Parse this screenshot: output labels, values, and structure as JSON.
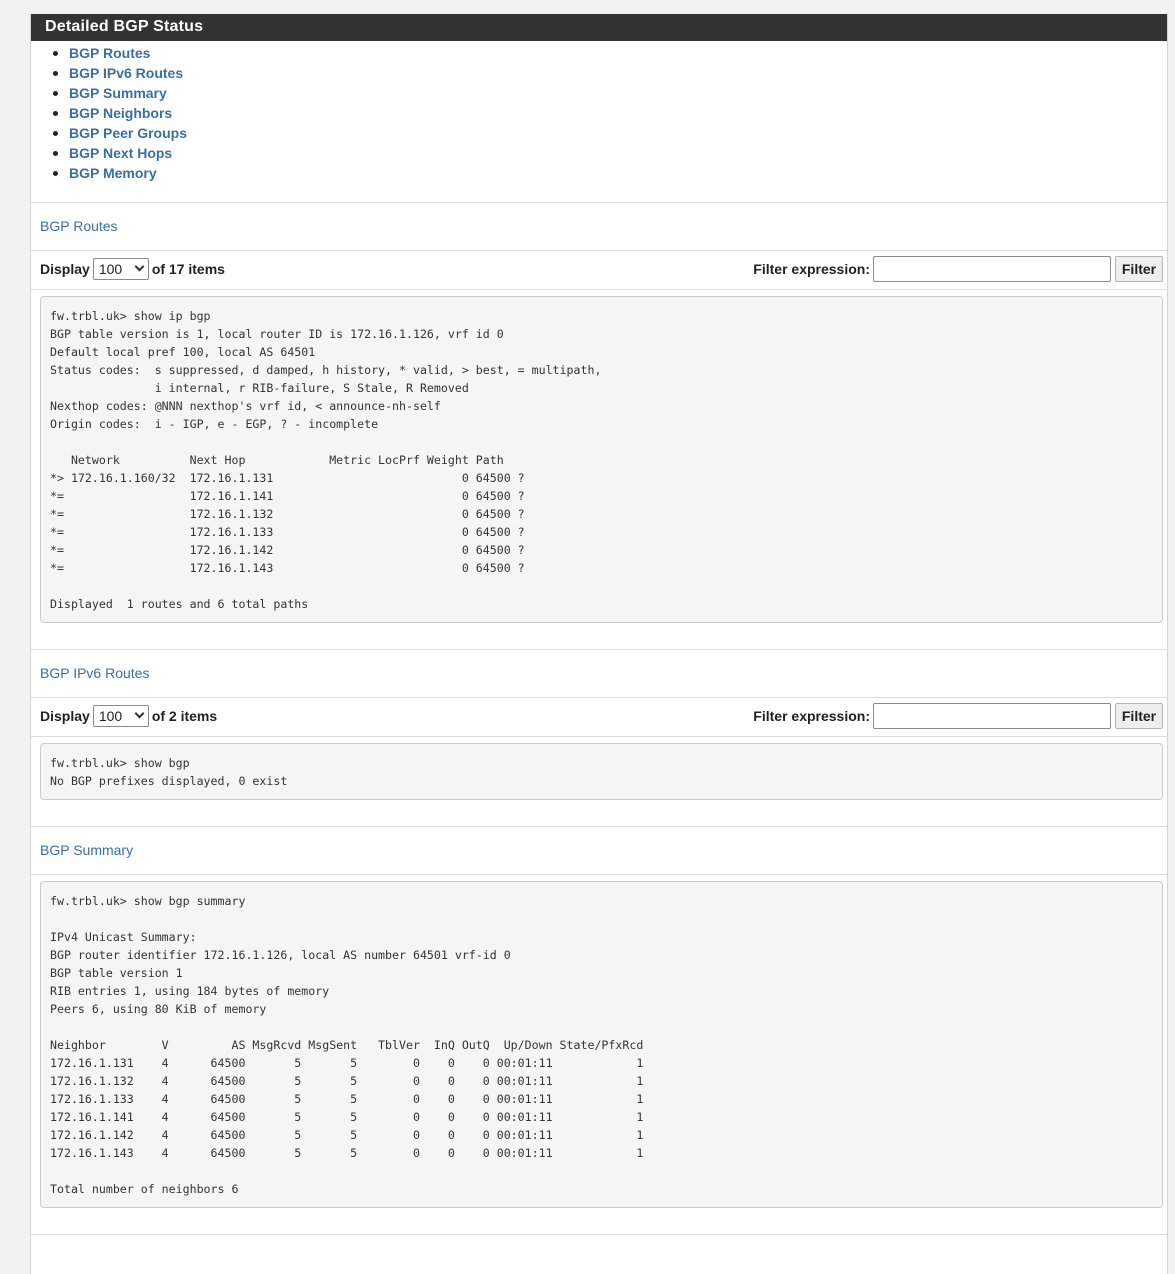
{
  "panel": {
    "title": "Detailed BGP Status",
    "toc": [
      "BGP Routes",
      "BGP IPv6 Routes",
      "BGP Summary",
      "BGP Neighbors",
      "BGP Peer Groups",
      "BGP Next Hops",
      "BGP Memory"
    ]
  },
  "routes": {
    "title": "BGP Routes",
    "display_label": "Display",
    "display_value": "100",
    "items_text": "of 17 items",
    "filter_label": "Filter expression:",
    "filter_value": "",
    "filter_button": "Filter",
    "output": "fw.trbl.uk> show ip bgp\nBGP table version is 1, local router ID is 172.16.1.126, vrf id 0\nDefault local pref 100, local AS 64501\nStatus codes:  s suppressed, d damped, h history, * valid, > best, = multipath,\n               i internal, r RIB-failure, S Stale, R Removed\nNexthop codes: @NNN nexthop's vrf id, < announce-nh-self\nOrigin codes:  i - IGP, e - EGP, ? - incomplete\n\n   Network          Next Hop            Metric LocPrf Weight Path\n*> 172.16.1.160/32  172.16.1.131                           0 64500 ?\n*=                  172.16.1.141                           0 64500 ?\n*=                  172.16.1.132                           0 64500 ?\n*=                  172.16.1.133                           0 64500 ?\n*=                  172.16.1.142                           0 64500 ?\n*=                  172.16.1.143                           0 64500 ?\n\nDisplayed  1 routes and 6 total paths"
  },
  "ipv6": {
    "title": "BGP IPv6 Routes",
    "display_label": "Display",
    "display_value": "100",
    "items_text": "of 2 items",
    "filter_label": "Filter expression:",
    "filter_value": "",
    "filter_button": "Filter",
    "output": "fw.trbl.uk> show bgp\nNo BGP prefixes displayed, 0 exist"
  },
  "summary": {
    "title": "BGP Summary",
    "output": "fw.trbl.uk> show bgp summary\n\nIPv4 Unicast Summary:\nBGP router identifier 172.16.1.126, local AS number 64501 vrf-id 0\nBGP table version 1\nRIB entries 1, using 184 bytes of memory\nPeers 6, using 80 KiB of memory\n\nNeighbor        V         AS MsgRcvd MsgSent   TblVer  InQ OutQ  Up/Down State/PfxRcd\n172.16.1.131    4      64500       5       5        0    0    0 00:01:11            1\n172.16.1.132    4      64500       5       5        0    0    0 00:01:11            1\n172.16.1.133    4      64500       5       5        0    0    0 00:01:11            1\n172.16.1.141    4      64500       5       5        0    0    0 00:01:11            1\n172.16.1.142    4      64500       5       5        0    0    0 00:01:11            1\n172.16.1.143    4      64500       5       5        0    0    0 00:01:11            1\n\nTotal number of neighbors 6"
  }
}
